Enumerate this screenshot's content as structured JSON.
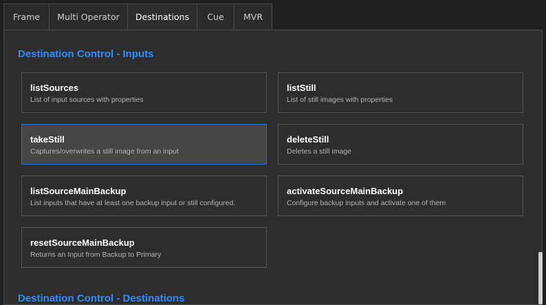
{
  "tabs": [
    {
      "label": "Frame",
      "active": false
    },
    {
      "label": "Multi Operator",
      "active": false
    },
    {
      "label": "Destinations",
      "active": true
    },
    {
      "label": "Cue",
      "active": false
    },
    {
      "label": "MVR",
      "active": false
    }
  ],
  "sections": [
    {
      "title": "Destination Control - Inputs"
    },
    {
      "title": "Destination Control - Destinations"
    }
  ],
  "cards": [
    {
      "name": "listSources",
      "desc": "List of input sources with properties",
      "selected": false
    },
    {
      "name": "listStill",
      "desc": "List of still images with properties",
      "selected": false
    },
    {
      "name": "takeStill",
      "desc": "Captures/overwrites a still image from an input",
      "selected": true
    },
    {
      "name": "deleteStill",
      "desc": "Deletes a still image",
      "selected": false
    },
    {
      "name": "listSourceMainBackup",
      "desc": "List inputs that have at least one backup input or still configured.",
      "selected": false
    },
    {
      "name": "activateSourceMainBackup",
      "desc": "Configure backup inputs and activate one of them",
      "selected": false
    },
    {
      "name": "resetSourceMainBackup",
      "desc": "Returns an Input from Backup to Primary",
      "selected": false
    }
  ],
  "colors": {
    "accent": "#2f8dff",
    "selected_border": "#2a6fe0"
  }
}
